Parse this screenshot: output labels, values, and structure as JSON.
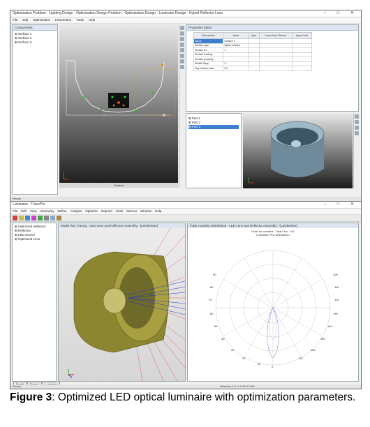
{
  "top": {
    "title": "Optimization Problem - Lighting Design - Optimization Design Problem - Optimization Design - Luminaire Design - Hybrid Reflector Lens",
    "window_controls": "–  □  ✕",
    "menu": [
      "File",
      "Edit",
      "Optimization",
      "Parameters",
      "Tools",
      "Help"
    ],
    "tree_title": "Components",
    "tree_items": [
      "Surface 1",
      "Surface 2",
      "Surface 3"
    ],
    "properties_title": "Properties Editor",
    "columns": [
      "Description",
      "Value",
      "Type",
      "Lower limit / Bound",
      "Upper limit"
    ],
    "rows": [
      {
        "desc": "Name",
        "value": "Surface 1",
        "selected": true
      },
      {
        "desc": "Surface type",
        "value": "Spline surface",
        "selected": false
      },
      {
        "desc": "Surface ID",
        "value": "1",
        "selected": false
      },
      {
        "desc": "Surface coating",
        "value": "",
        "selected": false
      },
      {
        "desc": "Surface property",
        "value": "",
        "selected": false
      },
      {
        "desc": "Visible Rays",
        "value": "",
        "selected": false
      },
      {
        "desc": "Ray surface data",
        "value": "0.5",
        "selected": false
      }
    ],
    "tree2_items": [
      "Part 1",
      "Part 2",
      "Part 3"
    ],
    "viewport_label": "Contour",
    "status": "Ready"
  },
  "bottom": {
    "title": "Luminaire - TracePro",
    "window_controls": "–  □  ✕",
    "menu": [
      "File",
      "Edit",
      "View",
      "Geometry",
      "Define",
      "Analysis",
      "Optimize",
      "Reports",
      "Tools",
      "Macros",
      "Window",
      "Help"
    ],
    "tree_items": [
      "Optimized Reflector",
      "Reflector",
      "LED Source",
      "Optimized Lens"
    ],
    "view3d_title": "Model Ray Tracing - LED Lens and Reflector Assembly - [Lambertian]",
    "polar_title": "Polar Candela Distribution - LED Lens and Reflector Assembly - [Lambertian]",
    "polar_sub1": "Polar Iso-candela - Total Flux: 1.61",
    "polar_sub2": "Luminaire Flux Distribution",
    "polar_labels": [
      "0",
      "10",
      "20",
      "30",
      "40",
      "50",
      "60",
      "70",
      "80",
      "90",
      "100",
      "110",
      "120",
      "130",
      "140",
      "150",
      "160",
      "170"
    ],
    "tabs": [
      "Model",
      "Source",
      "Luminaire"
    ],
    "status_left": "Ready",
    "status_right": "Selection 1/1: X 0.00 Y 0.00"
  },
  "caption": {
    "bold": "Figure 3",
    "text": ": Optimized LED optical luminaire with optimization parameters."
  }
}
